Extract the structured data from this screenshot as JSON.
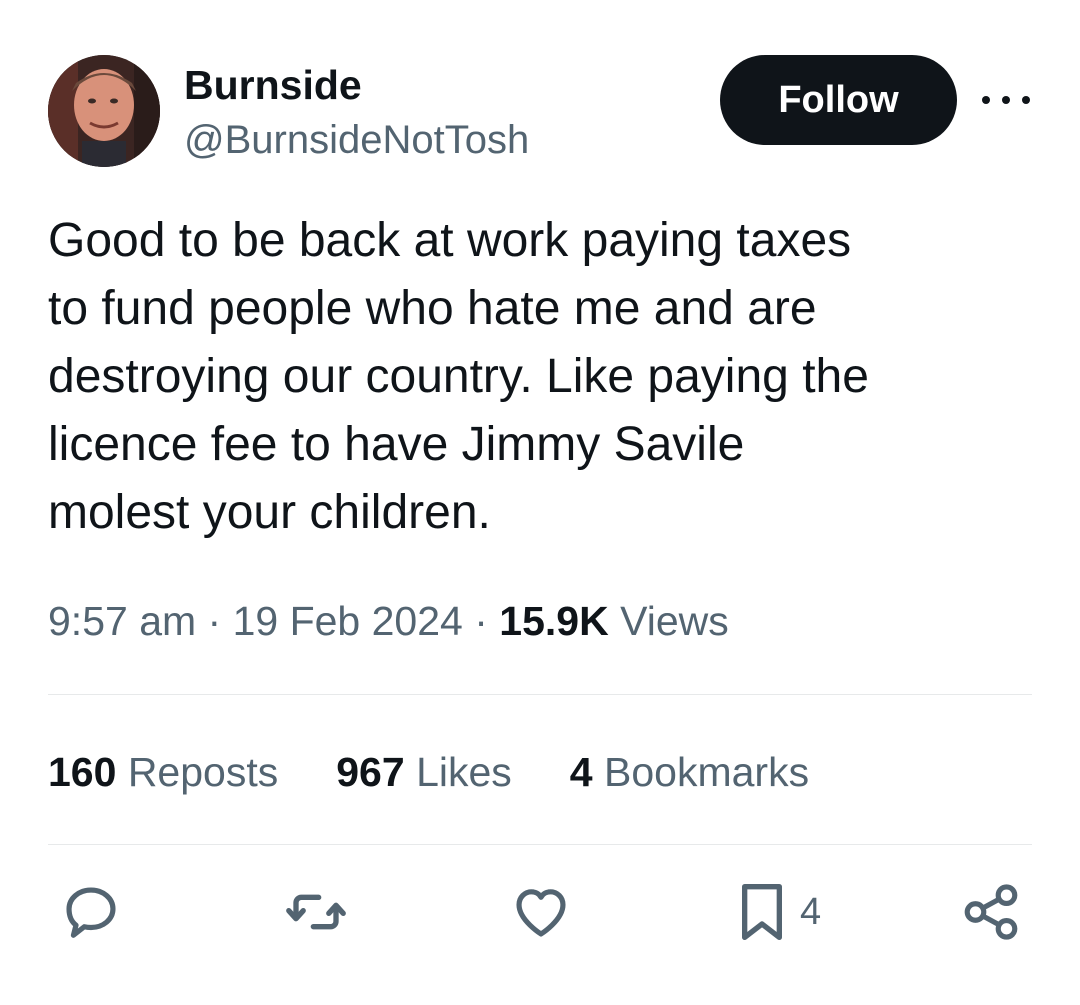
{
  "author": {
    "display_name": "Burnside",
    "handle": "@BurnsideNotTosh"
  },
  "follow_label": "Follow",
  "tweet": {
    "text": "Good to be back at work paying taxes\nto fund people who hate me and are\ndestroying our country. Like paying the\nlicence fee to have Jimmy Savile\nmolest your children.",
    "time": "9:57 am",
    "separator": " · ",
    "date": "19 Feb 2024",
    "views_count": "15.9K",
    "views_label": "Views"
  },
  "stats": [
    {
      "count": "160",
      "label": "Reposts"
    },
    {
      "count": "967",
      "label": "Likes"
    },
    {
      "count": "4",
      "label": "Bookmarks"
    }
  ],
  "actions": {
    "bookmark_count": "4"
  },
  "icons": [
    "reply-icon",
    "repost-icon",
    "like-icon",
    "bookmark-icon",
    "share-icon",
    "more-icon"
  ],
  "colors": {
    "text": "#0f1419",
    "secondary": "#536471",
    "divider": "#e7e9ea",
    "button": "#0f1419"
  }
}
